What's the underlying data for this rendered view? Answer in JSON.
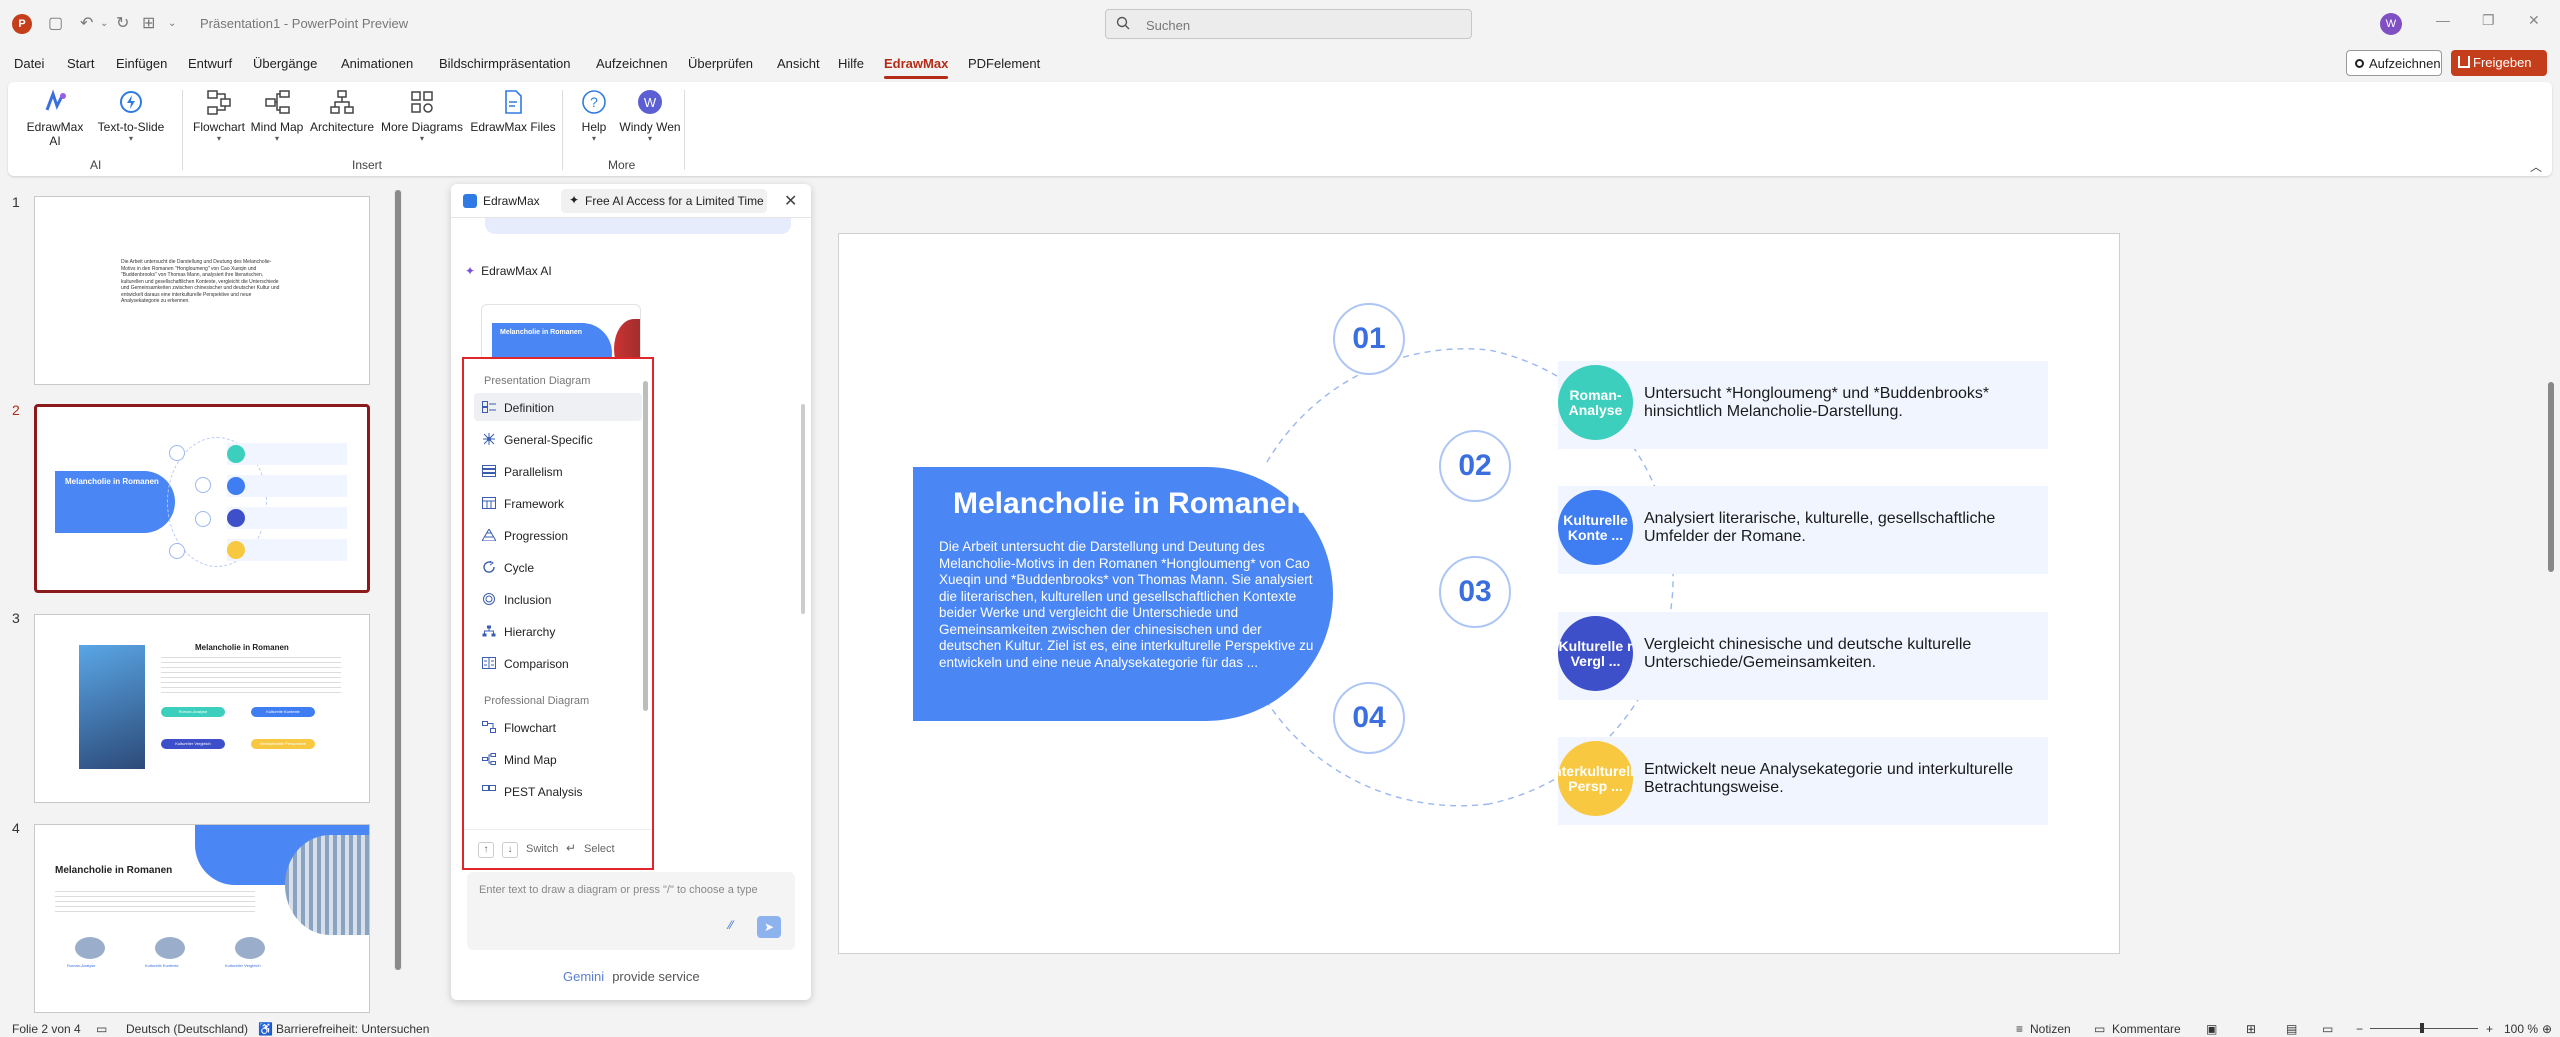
{
  "titlebar": {
    "app_letter": "P",
    "doc_title": "Präsentation1 - PowerPoint Preview",
    "search_placeholder": "Suchen",
    "user_initial": "W"
  },
  "menu": {
    "items": [
      "Datei",
      "Start",
      "Einfügen",
      "Entwurf",
      "Übergänge",
      "Animationen",
      "Bildschirmpräsentation",
      "Aufzeichnen",
      "Überprüfen",
      "Ansicht",
      "Hilfe",
      "EdrawMax",
      "PDFelement"
    ],
    "active": "EdrawMax",
    "record_label": "Aufzeichnen",
    "share_label": "Freigeben"
  },
  "ribbon": {
    "buttons": {
      "edrawmax_ai": "EdrawMax AI",
      "text_to_slide": "Text-to-Slide",
      "flowchart": "Flowchart",
      "mind_map": "Mind Map",
      "architecture": "Architecture",
      "more_diagrams": "More Diagrams",
      "edrawmax_files": "EdrawMax Files",
      "help": "Help",
      "user": "Windy Wen"
    },
    "groups": {
      "ai": "AI",
      "insert": "Insert",
      "more": "More"
    }
  },
  "thumbnails": {
    "numbers": [
      "1",
      "2",
      "3",
      "4"
    ],
    "selected": "2",
    "slide1_text": "Die Arbeit untersucht die Darstellung und Deutung des Melancholie-Motivs in den Romanen \"Hongloumeng\" von Cao Xueqin und \"Buddenbrooks\" von Thomas Mann, analysiert ihre literarischen, kulturellen und gesellschaftlichen Kontexte, vergleicht die Unterschiede und Gemeinsamkeiten zwischen chinesischer und deutscher Kultur und entwickelt daraus eine interkulturelle Perspektive und neue Analysekategorie zu erkennen.",
    "slide_title": "Melancholie in Romanen",
    "slide3_pills": [
      "Roman-Analyse",
      "Kulturelle Kontexte",
      "Kultureller Vergleich",
      "Interkulturelle Perspektive"
    ],
    "slide4_cols": [
      "Roman-Analyse",
      "Kulturelle Kontexte",
      "Kultureller Vergleich"
    ]
  },
  "panel": {
    "name": "EdrawMax",
    "promo": "Free AI Access for a Limited Time",
    "ai_label": "EdrawMax AI",
    "card_title": "Melancholie in Romanen",
    "prompt_placeholder": "Enter text to draw a diagram or press \"/\" to choose a type",
    "gemini_brand": "Gemini",
    "gemini_text": "provide service"
  },
  "dropdown": {
    "section1": "Presentation Diagram",
    "items1": [
      "Definition",
      "General-Specific",
      "Parallelism",
      "Framework",
      "Progression",
      "Cycle",
      "Inclusion",
      "Hierarchy",
      "Comparison"
    ],
    "active_item": "Definition",
    "section2": "Professional Diagram",
    "items2": [
      "Flowchart",
      "Mind Map",
      "PEST Analysis"
    ],
    "footer_switch": "Switch",
    "footer_select": "Select"
  },
  "slide": {
    "title": "Melancholie in Romanen",
    "body": "Die Arbeit untersucht die Darstellung und Deutung des Melancholie-Motivs in den Romanen *Hongloumeng* von Cao Xueqin und *Buddenbrooks* von Thomas Mann. Sie analysiert die literarischen, kulturellen und gesellschaftlichen Kontexte beider Werke und vergleicht die Unterschiede und Gemeinsamkeiten zwischen der chinesischen und der deutschen Kultur. Ziel ist es, eine interkulturelle Perspektive zu entwickeln und eine neue Analysekategorie für das  ...",
    "numbers": [
      "01",
      "02",
      "03",
      "04"
    ],
    "items": [
      {
        "badge": "Roman-Analyse",
        "text": "Untersucht *Hongloumeng* und *Buddenbrooks* hinsichtlich Melancholie-Darstellung.",
        "color": "#3ccfbd"
      },
      {
        "badge": "Kulturelle Konte ...",
        "text": "Analysiert literarische, kulturelle, gesellschaftliche Umfelder der Romane.",
        "color": "#3f7df2"
      },
      {
        "badge": "Kulturelle r Vergl ...",
        "text": "Vergleicht chinesische und deutsche kulturelle Unterschiede/Gemeinsamkeiten.",
        "color": "#3d50c9"
      },
      {
        "badge": "Interkulturelle Persp ...",
        "text": "Entwickelt neue Analysekategorie und interkulturelle Betrachtungsweise.",
        "color": "#f8c840"
      }
    ]
  },
  "status": {
    "slide_info": "Folie 2 von 4",
    "language": "Deutsch (Deutschland)",
    "accessibility": "Barrierefreiheit: Untersuchen",
    "notes": "Notizen",
    "comments": "Kommentare",
    "zoom": "100 %"
  },
  "colors": {
    "accent": "#b52b17",
    "slide_blue": "#4a86f4",
    "selection_red": "#e0262b"
  }
}
